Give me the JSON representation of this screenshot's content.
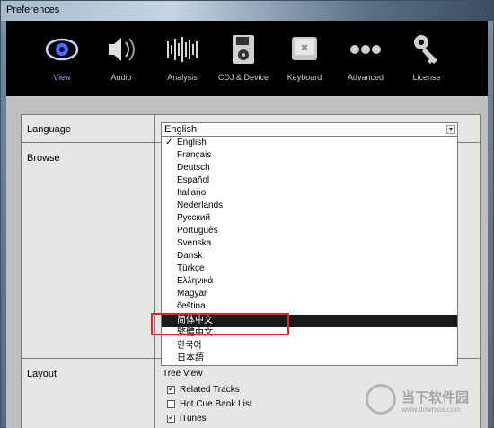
{
  "window": {
    "title": "Preferences"
  },
  "toolbar": {
    "items": [
      {
        "label": "View",
        "icon": "eye-icon"
      },
      {
        "label": "Audio",
        "icon": "speaker-icon"
      },
      {
        "label": "Analysis",
        "icon": "waveform-icon"
      },
      {
        "label": "CDJ & Device",
        "icon": "floppy-disk-icon"
      },
      {
        "label": "Keyboard",
        "icon": "keyboard-key-icon"
      },
      {
        "label": "Advanced",
        "icon": "dots-icon"
      },
      {
        "label": "License",
        "icon": "key-icon"
      }
    ],
    "active_color": "#8ea8ff"
  },
  "sections": {
    "language_label": "Language",
    "browse_label": "Browse",
    "layout_label": "Layout"
  },
  "language_select": {
    "value": "English",
    "options": [
      {
        "label": "English",
        "checked": true
      },
      {
        "label": "Français"
      },
      {
        "label": "Deutsch"
      },
      {
        "label": "Español"
      },
      {
        "label": "Italiano"
      },
      {
        "label": "Nederlands"
      },
      {
        "label": "Русский"
      },
      {
        "label": "Português"
      },
      {
        "label": "Svenska"
      },
      {
        "label": "Dansk"
      },
      {
        "label": "Türkçe"
      },
      {
        "label": "Ελληνικά"
      },
      {
        "label": "Magyar"
      },
      {
        "label": "čeština"
      },
      {
        "label": "简体中文",
        "highlighted": true
      },
      {
        "label": "繁體中文"
      },
      {
        "label": "한국어"
      },
      {
        "label": "日本語"
      }
    ]
  },
  "layout": {
    "tree_view_label": "Tree View",
    "checkboxes": [
      {
        "label": "Related Tracks",
        "checked": true
      },
      {
        "label": "Hot Cue Bank List",
        "checked": false
      },
      {
        "label": "iTunes",
        "checked": true
      }
    ]
  },
  "watermark": {
    "text": "当下软件园",
    "sub": "www.downxia.com"
  },
  "colors": {
    "highlight_box": "#e8222a",
    "selected_bg": "#1a1a1a"
  }
}
